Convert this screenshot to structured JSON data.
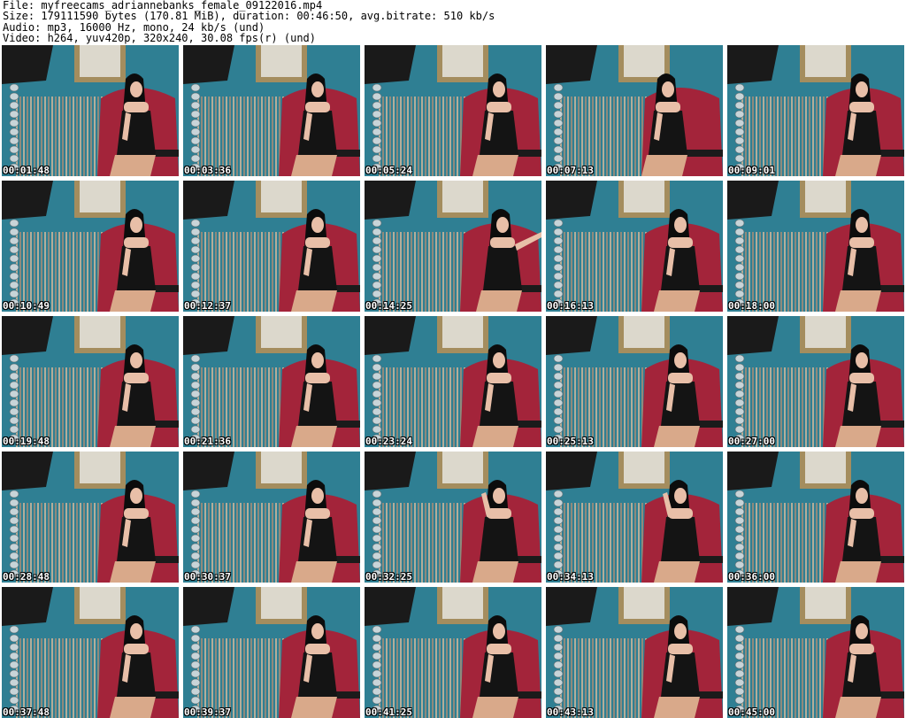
{
  "header": {
    "lines": [
      "File: myfreecams_adriannebanks_female_09122016.mp4",
      "Size: 179111590 bytes (170.81 MiB), duration: 00:46:50, avg.bitrate: 510 kb/s",
      "Audio: mp3, 16000 Hz, mono, 24 kb/s (und)",
      "Video: h264, yuv420p, 320x240, 30.08 fps(r) (und)"
    ]
  },
  "colors": {
    "wall": "#2f7f93",
    "curtain": "#c9c1ad",
    "chair": "#a3243a",
    "lamp_shade": "#1a1a1a",
    "outfit": "#141414",
    "skin": "#e8bfa8",
    "hair": "#0c0c0c"
  },
  "thumbnails": [
    {
      "timestamp": "00:01:48",
      "pose": "sitting"
    },
    {
      "timestamp": "00:03:36",
      "pose": "sitting"
    },
    {
      "timestamp": "00:05:24",
      "pose": "sitting"
    },
    {
      "timestamp": "00:07:13",
      "pose": "leaning"
    },
    {
      "timestamp": "00:09:01",
      "pose": "sitting"
    },
    {
      "timestamp": "00:10:49",
      "pose": "sitting"
    },
    {
      "timestamp": "00:12:37",
      "pose": "sitting"
    },
    {
      "timestamp": "00:14:25",
      "pose": "arm-raised"
    },
    {
      "timestamp": "00:16:13",
      "pose": "sitting"
    },
    {
      "timestamp": "00:18:00",
      "pose": "sitting"
    },
    {
      "timestamp": "00:19:48",
      "pose": "sitting"
    },
    {
      "timestamp": "00:21:36",
      "pose": "sitting"
    },
    {
      "timestamp": "00:23:24",
      "pose": "sitting"
    },
    {
      "timestamp": "00:25:13",
      "pose": "sitting"
    },
    {
      "timestamp": "00:27:00",
      "pose": "sitting"
    },
    {
      "timestamp": "00:28:48",
      "pose": "sitting"
    },
    {
      "timestamp": "00:30:37",
      "pose": "sitting"
    },
    {
      "timestamp": "00:32:25",
      "pose": "hand-in-hair"
    },
    {
      "timestamp": "00:34:13",
      "pose": "hand-in-hair"
    },
    {
      "timestamp": "00:36:00",
      "pose": "sitting"
    },
    {
      "timestamp": "00:37:48",
      "pose": "sitting"
    },
    {
      "timestamp": "00:39:37",
      "pose": "sitting"
    },
    {
      "timestamp": "00:41:25",
      "pose": "sitting"
    },
    {
      "timestamp": "00:43:13",
      "pose": "sitting"
    },
    {
      "timestamp": "00:45:00",
      "pose": "sitting"
    }
  ]
}
